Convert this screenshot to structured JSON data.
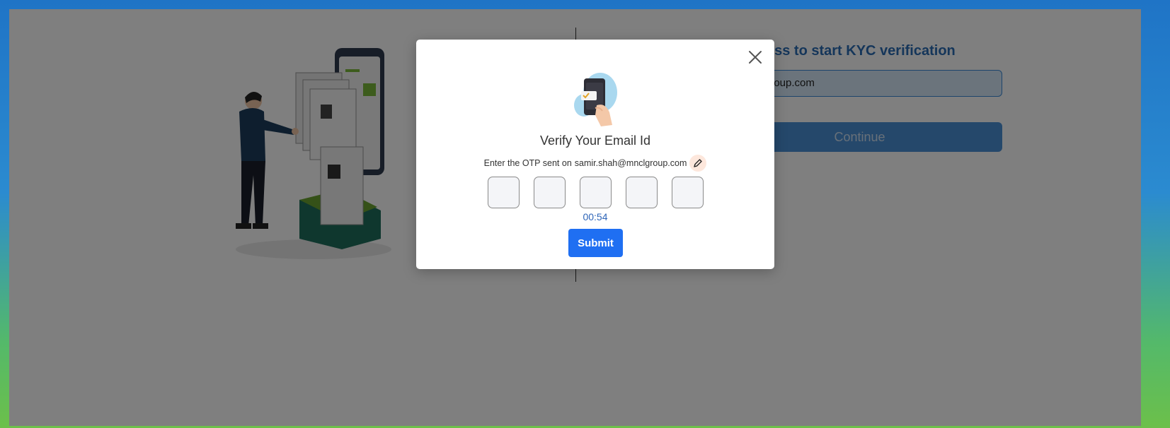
{
  "background_page": {
    "title": "dress to start KYC verification",
    "email_value": "group.com",
    "continue_label": "Continue"
  },
  "modal": {
    "title": "Verify Your Email Id",
    "subtitle_prefix": "Enter the OTP sent on",
    "email": "samir.shah@mnclgroup.com",
    "timer": "00:54",
    "submit_label": "Submit",
    "otp_digits": [
      "",
      "",
      "",
      "",
      ""
    ]
  },
  "colors": {
    "brand_blue": "#1f6ff2",
    "timer_blue": "#2e65b8",
    "frame_top": "#1f74c6",
    "frame_bottom": "#6cc04a"
  },
  "icons": {
    "close": "close-icon",
    "edit": "pencil-icon",
    "phone_illustration": "phone-otp-illustration"
  }
}
